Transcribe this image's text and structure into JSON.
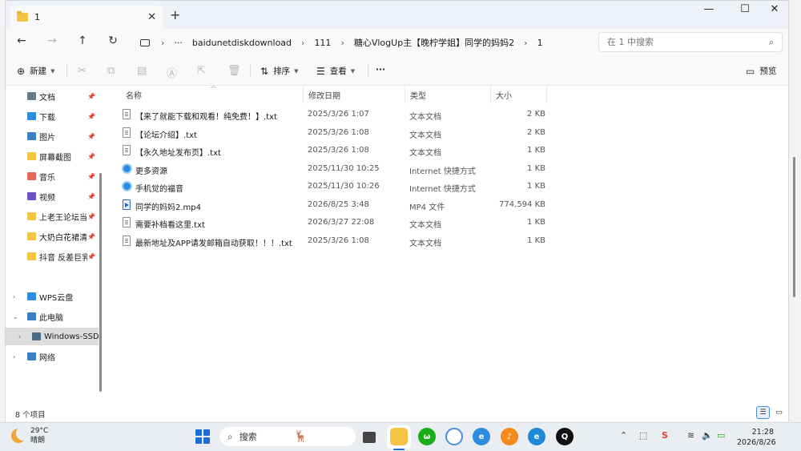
{
  "tab": {
    "title": "1",
    "close": "✕",
    "new_tab": "+"
  },
  "window_controls": {
    "minimize": "—",
    "maximize": "☐",
    "close": "✕"
  },
  "nav": {
    "back": "←",
    "forward": "→",
    "up": "↑",
    "refresh": "↻"
  },
  "address": {
    "more": "···",
    "separator": "›",
    "crumbs": [
      "baidunetdiskdownload",
      "111",
      "糖心VlogUp主【晚柠学姐】同学的妈妈2",
      "1"
    ]
  },
  "search": {
    "placeholder": "在 1 中搜索",
    "icon": "search-icon"
  },
  "commands": {
    "new": "新建",
    "sort": "排序",
    "view": "查看",
    "more": "···",
    "preview": "预览",
    "disabled_icons": [
      "cut-icon",
      "copy-icon",
      "paste-icon",
      "rename-icon",
      "share-icon",
      "delete-icon"
    ]
  },
  "sidebar": {
    "quick_access": [
      {
        "label": "文档",
        "icon": "documents-icon",
        "color": "#6b7b8c"
      },
      {
        "label": "下载",
        "icon": "download-icon",
        "color": "#2d8ce0"
      },
      {
        "label": "图片",
        "icon": "pictures-icon",
        "color": "#3a7fc4"
      },
      {
        "label": "屏幕截图",
        "icon": "folder-icon",
        "color": "#f4c442"
      },
      {
        "label": "音乐",
        "icon": "music-icon",
        "color": "#e8665a"
      },
      {
        "label": "视频",
        "icon": "videos-icon",
        "color": "#6b4fc4"
      },
      {
        "label": "上老王论坛当",
        "icon": "folder-icon",
        "color": "#f4c442"
      },
      {
        "label": "大奶白花裙清",
        "icon": "folder-icon",
        "color": "#f4c442"
      },
      {
        "label": "抖音 反差巨乳",
        "icon": "folder-icon",
        "color": "#f4c442"
      }
    ],
    "tree": [
      {
        "label": "WPS云盘",
        "icon": "cloud-icon",
        "expander": "›",
        "color": "#2d8ce0"
      },
      {
        "label": "此电脑",
        "icon": "computer-icon",
        "expander": "⌄",
        "color": "#3a7fc4"
      },
      {
        "label": "Windows-SSD",
        "icon": "drive-icon",
        "expander": "›",
        "color": "#4a6a8a",
        "selected": true
      },
      {
        "label": "网络",
        "icon": "network-icon",
        "expander": "›",
        "color": "#3a7fc4"
      }
    ]
  },
  "columns": {
    "name": "名称",
    "date": "修改日期",
    "type": "类型",
    "size": "大小"
  },
  "files": [
    {
      "name": "【来了就能下载和观看！纯免费！】.txt",
      "date": "2025/3/26 1:07",
      "type": "文本文档",
      "size": "2 KB",
      "icon": "text-file-icon"
    },
    {
      "name": "【论坛介绍】.txt",
      "date": "2025/3/26 1:08",
      "type": "文本文档",
      "size": "2 KB",
      "icon": "text-file-icon"
    },
    {
      "name": "【永久地址发布页】.txt",
      "date": "2025/3/26 1:08",
      "type": "文本文档",
      "size": "1 KB",
      "icon": "text-file-icon"
    },
    {
      "name": "更多资源",
      "date": "2025/11/30 10:25",
      "type": "Internet 快捷方式",
      "size": "1 KB",
      "icon": "internet-shortcut-icon"
    },
    {
      "name": "手机觉的福音",
      "date": "2025/11/30 10:26",
      "type": "Internet 快捷方式",
      "size": "1 KB",
      "icon": "internet-shortcut-icon"
    },
    {
      "name": "同学的妈妈2.mp4",
      "date": "2026/8/25 3:48",
      "type": "MP4 文件",
      "size": "774,594 KB",
      "icon": "video-file-icon"
    },
    {
      "name": "需要补档看这里.txt",
      "date": "2026/3/27 22:08",
      "type": "文本文档",
      "size": "1 KB",
      "icon": "text-file-icon"
    },
    {
      "name": "最新地址及APP请发邮箱自动获取！！！.txt",
      "date": "2025/3/26 1:08",
      "type": "文本文档",
      "size": "1 KB",
      "icon": "text-file-icon"
    }
  ],
  "status": {
    "count": "8 个项目"
  },
  "taskbar": {
    "weather": {
      "temp": "29°C",
      "condition": "晴朗"
    },
    "search_label": "搜索",
    "apps": [
      "file-explorer-icon",
      "wechat-icon",
      "baidu-netdisk-icon",
      "browser-icon",
      "music-app-icon",
      "edge-icon",
      "qq-icon"
    ],
    "clock": {
      "time": "21:28",
      "date": "2026/8/26"
    }
  }
}
